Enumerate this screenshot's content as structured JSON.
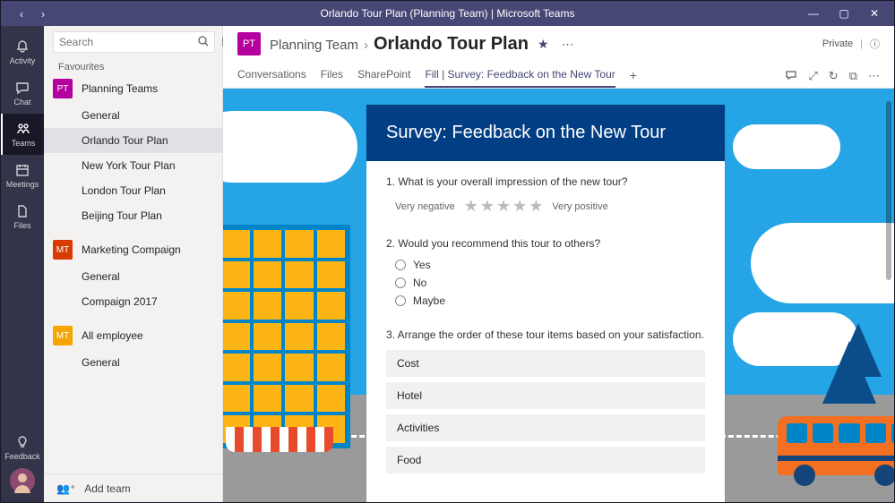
{
  "titlebar": {
    "title": "Orlando Tour Plan (Planning Team) | Microsoft Teams"
  },
  "apprail": {
    "activity": "Activity",
    "chat": "Chat",
    "teams": "Teams",
    "meetings": "Meetings",
    "files": "Files",
    "feedback": "Feedback"
  },
  "sidebar": {
    "search_placeholder": "Search",
    "favourites_label": "Favourites",
    "teams": [
      {
        "name": "Planning Teams",
        "initials": "PT",
        "color": "#b4009e",
        "channels": [
          "General",
          "Orlando Tour Plan",
          "New York Tour Plan",
          "London Tour Plan",
          "Beijing Tour Plan"
        ]
      },
      {
        "name": "Marketing Compaign",
        "initials": "MT",
        "color": "#d83b01",
        "channels": [
          "General",
          "Compaign 2017"
        ]
      },
      {
        "name": "All employee",
        "initials": "MT",
        "color": "#f7a500",
        "channels": [
          "General"
        ]
      }
    ],
    "selected_channel": "Orlando Tour Plan",
    "add_team": "Add team"
  },
  "header": {
    "team_initials": "PT",
    "parent": "Planning Team",
    "current": "Orlando Tour Plan",
    "privacy": "Private"
  },
  "tabs": {
    "items": [
      "Conversations",
      "Files",
      "SharePoint",
      "Fill | Survey: Feedback on the New Tour"
    ],
    "active_index": 3
  },
  "survey": {
    "title": "Survey: Feedback on the New Tour",
    "q1": {
      "text": "1. What is your overall impression of the new tour?",
      "left": "Very negative",
      "right": "Very positive"
    },
    "q2": {
      "text": "2. Would you recommend this tour to others?",
      "options": [
        "Yes",
        "No",
        "Maybe"
      ]
    },
    "q3": {
      "text": "3. Arrange the order of these tour items based on your satisfaction.",
      "items": [
        "Cost",
        "Hotel",
        "Activities",
        "Food"
      ]
    }
  }
}
